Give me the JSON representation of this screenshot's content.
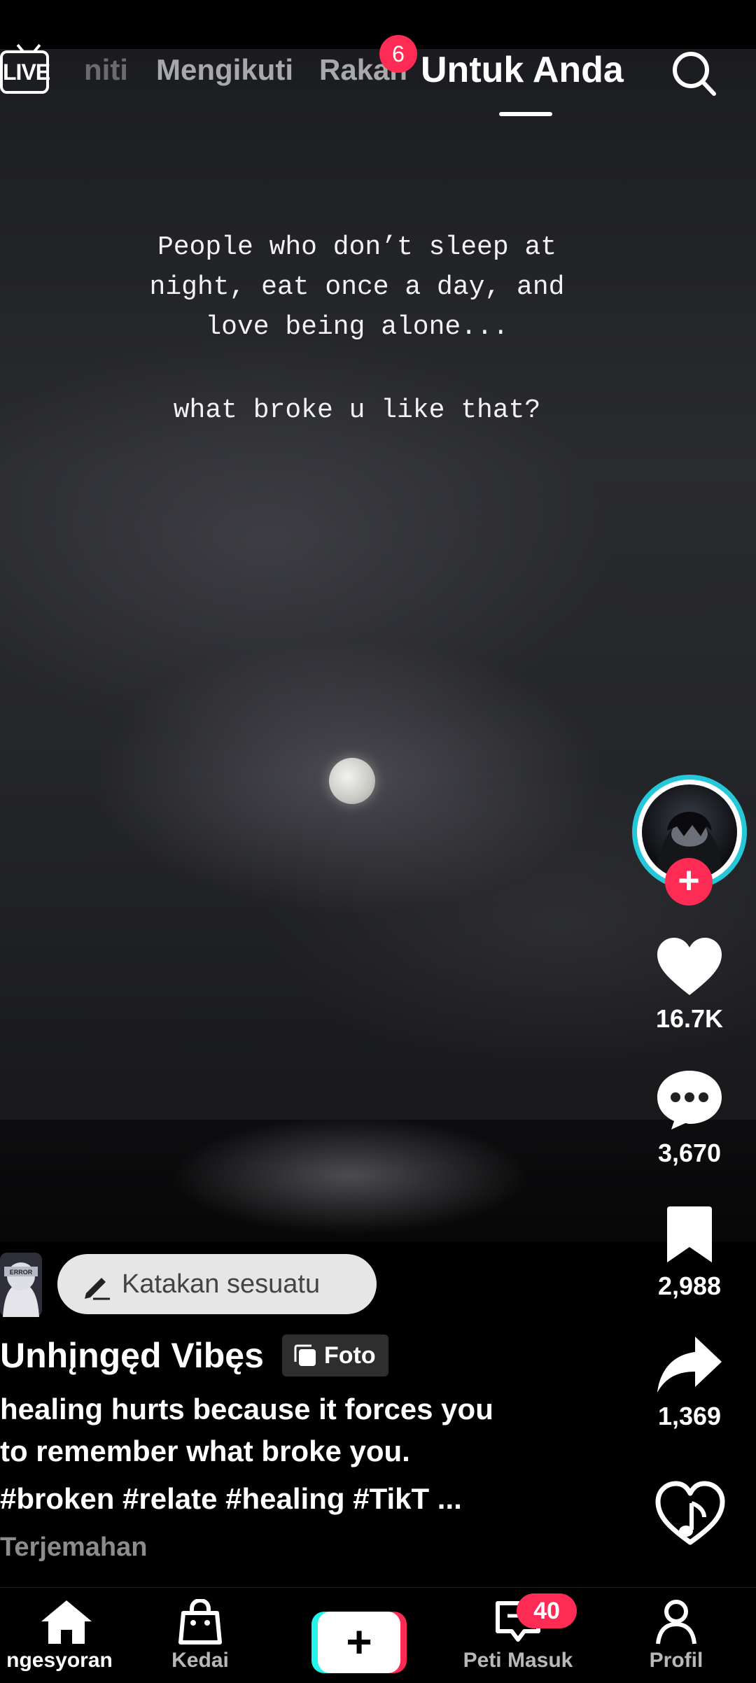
{
  "header": {
    "live_label": "LIVE",
    "tabs": [
      {
        "label": "niti"
      },
      {
        "label": "Mengikuti"
      },
      {
        "label": "Rakan",
        "badge": "6"
      },
      {
        "label": "Untuk Anda"
      }
    ]
  },
  "post": {
    "quote_line1": "People who don’t sleep at\nnight, eat once a day, and\nlove being alone...",
    "quote_line2": "what broke u like that?",
    "comment_prompt": "Katakan sesuatu",
    "author": "Unhįngęd Vibęs",
    "type_badge": "Foto",
    "caption": "healing hurts because it forces you\nto remember what broke you.",
    "hashtags": "#broken #relate #healing #TikT ...",
    "translate_label": "Terjemahan"
  },
  "actions": {
    "likes": "16.7K",
    "comments": "3,670",
    "saves": "2,988",
    "shares": "1,369"
  },
  "nav": {
    "items": [
      {
        "label": "ngesyoran"
      },
      {
        "label": "Kedai"
      },
      {
        "label": "Peti Masuk",
        "badge": "40"
      },
      {
        "label": "Profil"
      }
    ]
  },
  "colors": {
    "accent": "#fe2c55",
    "ring": "#25c8d9",
    "background": "#000000"
  }
}
